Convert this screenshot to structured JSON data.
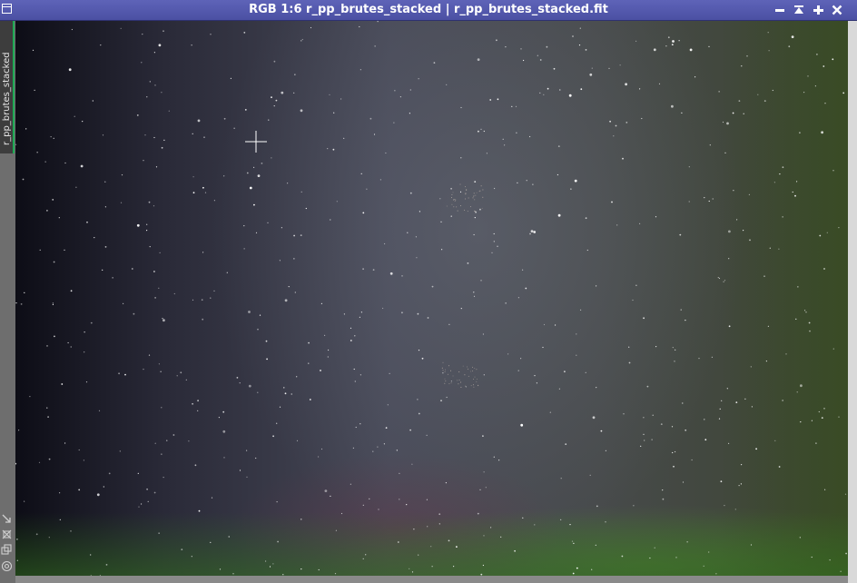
{
  "window": {
    "title": "RGB 1:6 r_pp_brutes_stacked | r_pp_brutes_stacked.fit",
    "view_mode": "RGB",
    "zoom": "1:6",
    "view_id": "r_pp_brutes_stacked",
    "file_name": "r_pp_brutes_stacked.fit",
    "titlebar_color": "#5459ad",
    "buttons": {
      "minimize": "minimize-icon",
      "shade": "shade-icon",
      "maximize": "maximize-icon",
      "close": "close-icon"
    }
  },
  "side_panel": {
    "tab_label": "r_pp_brutes_stacked",
    "tab_accent": "#1faa55",
    "tools": [
      "drag-arrow-icon",
      "link-icon",
      "clone-icon",
      "target-icon"
    ]
  },
  "image": {
    "description_color_left": "#0d0d16",
    "description_color_center": "#474957",
    "description_color_right": "#3c4530"
  }
}
